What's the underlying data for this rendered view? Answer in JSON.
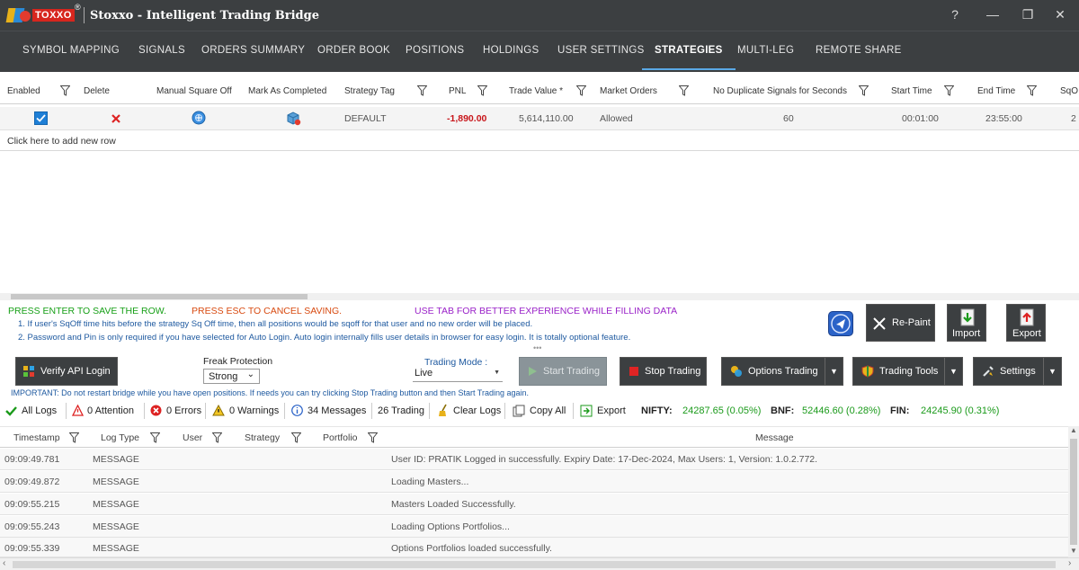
{
  "app": {
    "logo_text": "TOXXO",
    "title": "Stoxxo - Intelligent Trading Bridge",
    "help_glyph": "?",
    "minimize_glyph": "—",
    "maximize_glyph": "❐",
    "close_glyph": "✕"
  },
  "nav": {
    "tabs": [
      {
        "label": "SYMBOL MAPPING"
      },
      {
        "label": "SIGNALS"
      },
      {
        "label": "ORDERS SUMMARY"
      },
      {
        "label": "ORDER BOOK"
      },
      {
        "label": "POSITIONS"
      },
      {
        "label": "HOLDINGS"
      },
      {
        "label": "USER SETTINGS"
      },
      {
        "label": "STRATEGIES"
      },
      {
        "label": "MULTI-LEG"
      },
      {
        "label": "REMOTE SHARE"
      }
    ],
    "active_tab": "STRATEGIES"
  },
  "strategy_grid": {
    "columns": [
      "Enabled",
      "Delete",
      "Manual Square Off",
      "Mark As Completed",
      "Strategy Tag",
      "PNL",
      "Trade Value *",
      "Market Orders",
      "No Duplicate Signals for Seconds",
      "Start Time",
      "End Time",
      "SqO"
    ],
    "row": {
      "strategy_tag": "DEFAULT",
      "pnl": "-1,890.00",
      "trade_value": "5,614,110.00",
      "market_orders": "Allowed",
      "no_dup_seconds": "60",
      "start_time": "00:01:00",
      "end_time": "23:55:00",
      "sqo_partial": "2"
    },
    "add_row_text": "Click here to add new row"
  },
  "hints": {
    "enter": "PRESS ENTER TO SAVE THE ROW.",
    "esc": "PRESS ESC TO CANCEL SAVING.",
    "tab": "USE TAB FOR BETTER EXPERIENCE WHILE FILLING DATA",
    "note1": "1. If user's SqOff time hits before the strategy Sq Off time, then all positions would be sqoff for that user and no new order will be placed.",
    "note2": "2. Password and Pin is only required if you have selected for Auto Login. Auto login internally fills user details in browser for easy login. It is totally optional feature.",
    "colors": {
      "enter": "#18a018",
      "esc": "#d84a10",
      "tab": "#9a22c8"
    }
  },
  "actions": {
    "repaint": "Re-Paint",
    "import": "Import",
    "export": "Export"
  },
  "controls": {
    "verify_api": "Verify API Login",
    "freak_label": "Freak Protection",
    "freak_value": "Strong",
    "mode_label": "Trading Mode :",
    "mode_value": "Live",
    "start_trading": "Start Trading",
    "stop_trading": "Stop Trading",
    "options_trading": "Options Trading",
    "trading_tools": "Trading Tools",
    "settings": "Settings",
    "important": "IMPORTANT: Do not restart bridge while you have open positions. If needs you can try clicking Stop Trading button and then Start Trading again."
  },
  "logbar": {
    "all_logs": "All Logs",
    "attention": "0 Attention",
    "errors": "0 Errors",
    "warnings": "0 Warnings",
    "messages": "34 Messages",
    "trading": "26 Trading",
    "clear_logs": "Clear Logs",
    "copy_all": "Copy All",
    "export": "Export",
    "nifty_label": "NIFTY:",
    "nifty_value": "24287.65 (0.05%)",
    "bnf_label": "BNF:",
    "bnf_value": "52446.60 (0.28%)",
    "fin_label": "FIN:",
    "fin_value": "24245.90 (0.31%)"
  },
  "log_table": {
    "columns": [
      "Timestamp",
      "Log Type",
      "User",
      "Strategy",
      "Portfolio",
      "Message"
    ],
    "rows": [
      {
        "ts": "09:09:49.781",
        "type": "MESSAGE",
        "msg": "User ID: PRATIK  Logged in successfully. Expiry Date: 17-Dec-2024, Max Users: 1, Version: 1.0.2.772."
      },
      {
        "ts": "09:09:49.872",
        "type": "MESSAGE",
        "msg": "Loading Masters..."
      },
      {
        "ts": "09:09:55.215",
        "type": "MESSAGE",
        "msg": "Masters Loaded Successfully."
      },
      {
        "ts": "09:09:55.243",
        "type": "MESSAGE",
        "msg": "Loading Options Portfolios..."
      },
      {
        "ts": "09:09:55.339",
        "type": "MESSAGE",
        "msg": "Options Portfolios loaded successfully."
      }
    ]
  }
}
